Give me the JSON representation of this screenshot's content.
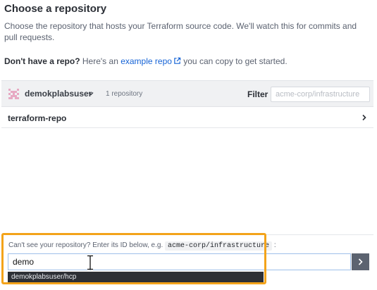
{
  "header": {
    "title": "Choose a repository",
    "description": "Choose the repository that hosts your Terraform source code. We'll watch this for commits and pull requests."
  },
  "no_repo": {
    "bold": "Don't have a repo?",
    "before_link": " Here's an ",
    "link": "example repo",
    "after_link": " you can copy to get started."
  },
  "org_bar": {
    "org_name": "demokplabsuser",
    "repo_count": "1 repository",
    "filter_label": "Filter",
    "filter_placeholder": "acme-corp/infrastructure"
  },
  "repos": [
    {
      "name": "terraform-repo"
    }
  ],
  "manual_entry": {
    "prompt": "Can't see your repository? Enter its ID below, e.g.",
    "example_id": "acme-corp/infrastructure",
    "suffix": ":",
    "input_value": "demo",
    "suggestion": "demokplabsuser/hcp"
  },
  "colors": {
    "highlight": "#f3a31a",
    "link": "#1563d6",
    "avatar": "#e7a9c3"
  },
  "icons": [
    "external-link-icon",
    "avatar-identicon",
    "chevron-down-icon",
    "chevron-right-icon",
    "i-beam-cursor-icon"
  ]
}
